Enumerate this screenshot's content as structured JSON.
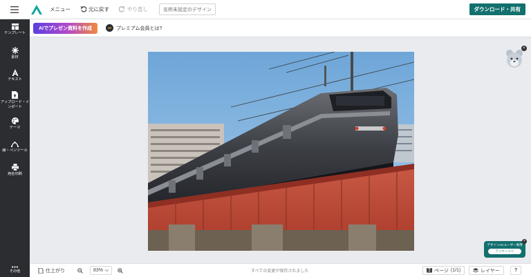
{
  "topbar": {
    "menu_label": "メニュー",
    "undo_label": "元に戻す",
    "redo_label": "やり直し",
    "title_placeholder": "名称未設定のデザイン",
    "download_label": "ダウンロード・共有"
  },
  "sidebar": {
    "items": [
      {
        "label": "テンプレート",
        "icon": "template-icon"
      },
      {
        "label": "素材",
        "icon": "material-icon"
      },
      {
        "label": "テキスト",
        "icon": "text-icon"
      },
      {
        "label": "アップロード・インポート",
        "icon": "upload-icon"
      },
      {
        "label": "テーマ",
        "icon": "palette-icon"
      },
      {
        "label": "線・ペンツール",
        "icon": "pen-tool-icon"
      },
      {
        "label": "宛名印刷",
        "icon": "print-icon"
      }
    ],
    "more_label": "その他"
  },
  "subbar": {
    "ai_button_label": "AIでプレゼン資料を作成",
    "premium_label": "プレミアム会員とは?",
    "vip_badge": "VIP"
  },
  "survey": {
    "title": "デザインACユーザー専用",
    "button_label": "アンケートへ"
  },
  "bottombar": {
    "finish_label": "仕上がり",
    "zoom_value": "83%",
    "status_text": "すべての変更が保存されました",
    "page_label": "ページ",
    "page_count": "(1/1)",
    "layer_label": "レイヤー",
    "help_label": "?"
  },
  "colors": {
    "brand": "#12706e",
    "sidebar_bg": "#2b2d31",
    "ai_gradient_start": "#5b3fe0",
    "ai_gradient_end": "#f08a3e"
  }
}
